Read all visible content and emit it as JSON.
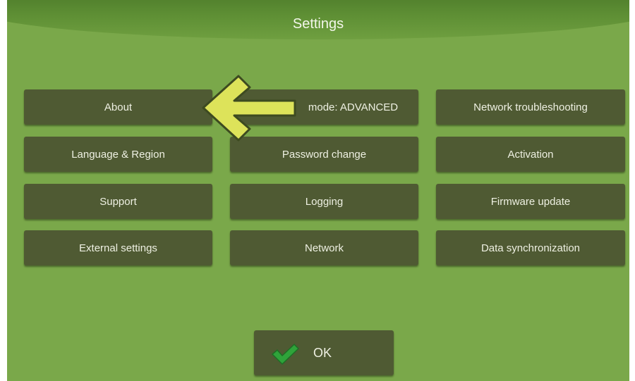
{
  "header": {
    "title": "Settings"
  },
  "buttons": {
    "about": "About",
    "mode": "mode:  ADVANCED",
    "network_troubleshooting": "Network troubleshooting",
    "language_region": "Language & Region",
    "password_change": "Password change",
    "activation": "Activation",
    "support": "Support",
    "logging": "Logging",
    "firmware_update": "Firmware update",
    "external_settings": "External settings",
    "network": "Network",
    "data_synchronization": "Data synchronization"
  },
  "footer": {
    "ok_label": "OK"
  },
  "icons": {
    "pointer": "arrow-left-icon",
    "confirm": "checkmark-icon"
  },
  "colors": {
    "background": "#7aa84a",
    "header": "#4e7d2b",
    "button": "#4f5a33",
    "button_text": "#eef0e2",
    "arrow": "#dde35a",
    "check": "#2fa33a"
  }
}
